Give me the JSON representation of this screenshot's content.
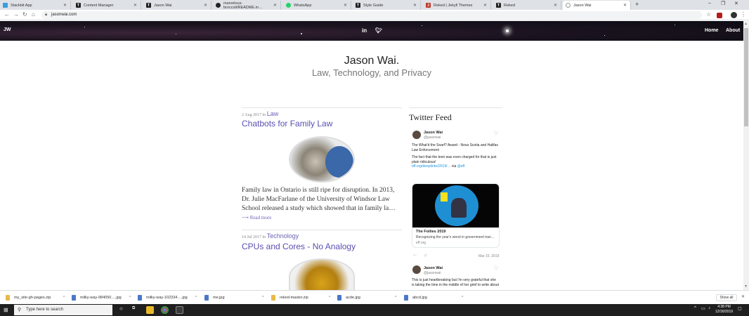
{
  "browser": {
    "tabs": [
      {
        "title": "Stackbit App",
        "color": "#3b9ddd",
        "icon": "stackbit-icon"
      },
      {
        "title": "Content Manager",
        "color": "#222222",
        "icon": "content-manager-icon"
      },
      {
        "title": "Jason Wai",
        "color": "#222222",
        "icon": "site-icon"
      },
      {
        "title": "marvelous-broccoli/README.m…",
        "color": "#222222",
        "icon": "github-icon"
      },
      {
        "title": "WhatsApp",
        "color": "#25d366",
        "icon": "whatsapp-icon"
      },
      {
        "title": "Style Guide",
        "color": "#222222",
        "icon": "site-icon"
      },
      {
        "title": "Reked | Jekyll Themes",
        "color": "#c0392b",
        "icon": "jekyll-icon"
      },
      {
        "title": "Reked",
        "color": "#222222",
        "icon": "site-icon"
      },
      {
        "title": "Jason Wai",
        "color": "#888888",
        "icon": "loading-icon"
      }
    ],
    "url": "jasonwai.com"
  },
  "site": {
    "brand": "JW",
    "nav": {
      "home": "Home",
      "about": "About"
    },
    "title": "Jason Wai.",
    "subtitle": "Law, Technology, and Privacy"
  },
  "posts": [
    {
      "date": "2 Aug 2017",
      "in": "in",
      "category": "Law",
      "title": "Chatbots for Family Law",
      "excerpt": "Family law in Ontario is still ripe for disruption. In 2013, Dr. Julie MacFarlane of the University of Windsor Law School released a study which showed that in family la…",
      "read_more": "⟶ Read more"
    },
    {
      "date": "14 Jul 2017",
      "in": "in",
      "category": "Technology",
      "title": "CPUs and Cores - No Analogy"
    }
  ],
  "twitter": {
    "title": "Twitter Feed",
    "tweets": [
      {
        "name": "Jason Wai",
        "handle": "@jasonwai",
        "line1": "The What'd the Snarf? Award - Nova Scotia and Halifax",
        "line2": "Law Enforcement",
        "line3": "The fact that the teen was even charged for that is just",
        "line4": "plain ridiculous!",
        "link": "eff.org/deeplinks/2019/…",
        "via": "via",
        "via_handle": "@eff"
      },
      {
        "name": "Jason Wai",
        "handle": "@jasonwai",
        "line1": "This is just heartbreaking but I'm very grateful that she",
        "line2": "is taking the time in the middle of her grief to write about"
      }
    ],
    "card": {
      "title": "The Foilies 2019",
      "desc": "Recognizing the year's worst in government tran…",
      "domain": "eff.org"
    },
    "date": "Mar 15, 2019"
  },
  "downloads": {
    "items": [
      {
        "name": "my_site-gh-pages.zip",
        "color": "#e8b84a"
      },
      {
        "name": "milky-way-984050….jpg",
        "color": "#4a78c9"
      },
      {
        "name": "milky-way-102334….jpg",
        "color": "#4a78c9"
      },
      {
        "name": "me.jpg",
        "color": "#4a78c9"
      },
      {
        "name": "reked-master.zip",
        "color": "#e8b84a"
      },
      {
        "name": "acde.jpg",
        "color": "#4a78c9"
      },
      {
        "name": "abcd.jpg",
        "color": "#4a78c9"
      }
    ],
    "show_all": "Show all"
  },
  "taskbar": {
    "search_placeholder": "Type here to search",
    "time": "4:38 PM",
    "date": "12/30/2019"
  }
}
